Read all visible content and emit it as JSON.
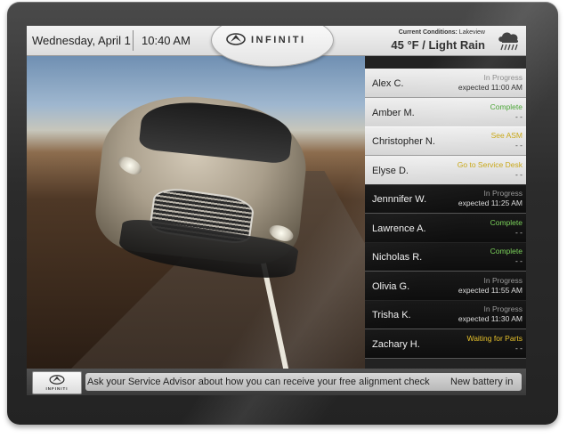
{
  "header": {
    "date": "Wednesday,  April 1",
    "time": "10:40 AM",
    "logo": "INFINITI",
    "weather_label_bold": "Current Conditions:",
    "weather_label_location": " Lakeview",
    "weather_value": "45 °F / Light Rain",
    "weather_icon": "rain-cloud-icon"
  },
  "customers": [
    {
      "name": "Alex C.",
      "status": "In Progress",
      "detail": "expected  11:00 AM",
      "status_color": "gray",
      "theme": "light"
    },
    {
      "name": "Amber M.",
      "status": "Complete",
      "detail": "- -",
      "status_color": "green",
      "theme": "light"
    },
    {
      "name": "Christopher N.",
      "status": "See ASM",
      "detail": "- -",
      "status_color": "yellow",
      "theme": "light"
    },
    {
      "name": "Elyse D.",
      "status": "Go to Service Desk",
      "detail": "- -",
      "status_color": "yellow",
      "theme": "light"
    },
    {
      "name": "Jennnifer W.",
      "status": "In Progress",
      "detail": "expected  11:25 AM",
      "status_color": "gray",
      "theme": "dark"
    },
    {
      "name": "Lawrence A.",
      "status": "Complete",
      "detail": "- -",
      "status_color": "green",
      "theme": "dark"
    },
    {
      "name": "Nicholas R.",
      "status": "Complete",
      "detail": "- -",
      "status_color": "green",
      "theme": "dark"
    },
    {
      "name": "Olivia G.",
      "status": "In Progress",
      "detail": "expected  11:55 AM",
      "status_color": "gray",
      "theme": "dark"
    },
    {
      "name": "Trisha K.",
      "status": "In Progress",
      "detail": "expected  11:30 AM",
      "status_color": "gray",
      "theme": "dark"
    },
    {
      "name": "Zachary H.",
      "status": "Waiting for Parts",
      "detail": "- -",
      "status_color": "yellow",
      "theme": "dark"
    }
  ],
  "ticker": {
    "logo_text": "INFINITI",
    "message": "Ask your Service Advisor about how you can receive your free alignment check",
    "message2": "New battery in"
  },
  "colors": {
    "complete": "#4ea73a",
    "attention": "#c9a81a",
    "progress": "#8e8e8e",
    "bezel": "#2b2b2b"
  }
}
